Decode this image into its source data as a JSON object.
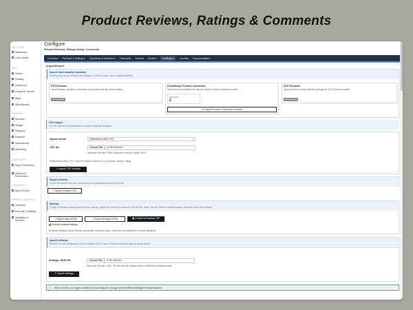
{
  "banner": "Product Reviews, Ratings & Comments",
  "sidebar": {
    "sections": [
      {
        "title": "WELCOME",
        "items": [
          {
            "label": "Dashboard",
            "icon": "dashboard-icon"
          },
          {
            "label": "Care Center",
            "icon": "care-center-icon"
          }
        ]
      },
      {
        "title": "SELL",
        "items": [
          {
            "label": "Orders",
            "icon": "orders-icon",
            "chevron": true
          },
          {
            "label": "Catalog",
            "icon": "catalog-icon",
            "chevron": true
          },
          {
            "label": "Customers",
            "icon": "customers-icon",
            "chevron": true
          },
          {
            "label": "Customer Service",
            "icon": "customer-service-icon",
            "chevron": true
          },
          {
            "label": "Stats",
            "icon": "stats-icon"
          },
          {
            "label": "Ultra Blocker",
            "icon": "ultra-blocker-icon"
          }
        ]
      },
      {
        "title": "IMPROVE",
        "items": [
          {
            "label": "Modules",
            "icon": "modules-icon",
            "chevron": true
          },
          {
            "label": "Design",
            "icon": "design-icon",
            "chevron": true
          },
          {
            "label": "Shipping",
            "icon": "shipping-icon",
            "chevron": true
          },
          {
            "label": "Payment",
            "icon": "payment-icon",
            "chevron": true
          },
          {
            "label": "International",
            "icon": "international-icon",
            "chevron": true
          },
          {
            "label": "Marketing",
            "icon": "marketing-icon",
            "chevron": true
          }
        ]
      },
      {
        "title": "CONFIGURE",
        "items": [
          {
            "label": "Shop Parameters",
            "icon": "shop-parameters-icon",
            "chevron": true
          },
          {
            "label": "Advanced Parameters",
            "icon": "advanced-parameters-icon",
            "chevron": true
          }
        ]
      },
      {
        "title": "COMMUNITY",
        "items": [
          {
            "label": "Wall of Fame",
            "icon": "wall-of-fame-icon"
          }
        ]
      },
      {
        "title": "PRODUCT REVIEWS",
        "items": [
          {
            "label": "Overview",
            "icon": "overview-icon"
          },
          {
            "label": "Reviews & Ratings",
            "icon": "reviews-icon"
          },
          {
            "label": "Questions & Answers",
            "icon": "questions-icon"
          }
        ]
      }
    ]
  },
  "header": {
    "title": "Configure",
    "subtitle": "Product Reviews, Ratings &amp; Comments"
  },
  "nav": {
    "tabs": [
      "Overview",
      "Reviews & Ratings ▾",
      "Questions & Answers ▾",
      "Discounts",
      "Authors",
      "Email ▾",
      "Settings ▾",
      "License",
      "Documentation"
    ],
    "active": "Settings ▾"
  },
  "page": {
    "section_title": "Import/Export",
    "import_installed": {
      "title": "Import from installed modules",
      "subtitle": "Existing imports are detected and skipped, so these actions can be safely repeated.",
      "cards": [
        {
          "title": "ETS Reviews",
          "desc": "Import reviews, questions, comments, and replies from ets_reviews tables.",
          "tag": "Not detected"
        },
        {
          "title": "PrestaShop Product Comments",
          "desc": "Import reviews submitted through the classic Product Comments module.",
          "reviews_label": "REVIEWS",
          "reviews_count": "2",
          "button": "Import Product Comments reviews"
        },
        {
          "title": "DJIT Reviews",
          "desc": "Import product reviews submitted through the DJIT Reviews module.",
          "tag": "Not detected"
        }
      ]
    },
    "csv_import": {
      "title": "CSV import",
      "subtitle": "Use this option for prepared files or custom migration adapters.",
      "format_label": "Import format",
      "format_value": "XtdReviews native CSV",
      "file_label": "CSV file",
      "choose_file": "Choose File",
      "no_file": "no file selected",
      "max_size": "Maximum file size: 8 MB. Maximum rows per import: 3000.",
      "required_cols": "XtdReviews native CSV: required columns: source_id, id_product, content, rating.",
      "button": "Import CSV reviews"
    },
    "export_reviews": {
      "title": "Export reviews",
      "subtitle": "Export all reviews from the current shop in a spreadsheet-friendly CSV file.",
      "button": "Export reviews CSV"
    },
    "backup": {
      "title": "Backup",
      "subtitle": "Create a structured backup with reviews, ratings, questions, answers, comments, media files, votes, reports, criteria, email templates, reminder rules, and settings.",
      "btn_export_data": "Export data JSON",
      "btn_export_settings": "Export settings JSON",
      "btn_full_backup": "Create full backup ZIP",
      "checkbox_label": "Include sensitive settings",
      "note": "Sensitive settings include license and private verification keys. Leave this unchecked for normal migrations."
    },
    "import_settings": {
      "title": "Import settings",
      "subtitle": "Restore module configuration from a settings JSON export. Sensitive keys are ignored during import.",
      "file_label": "Settings JSON file",
      "choose_file": "Choose File",
      "no_file": "no file selected",
      "note": "Maximum file size: 2 MB. The file must be created by the XtdReviews settings export.",
      "button": "Import settings"
    },
    "info_note": "Other modules can register additional import adapters through actionXtdReviewsRegisterImportAdapters."
  }
}
